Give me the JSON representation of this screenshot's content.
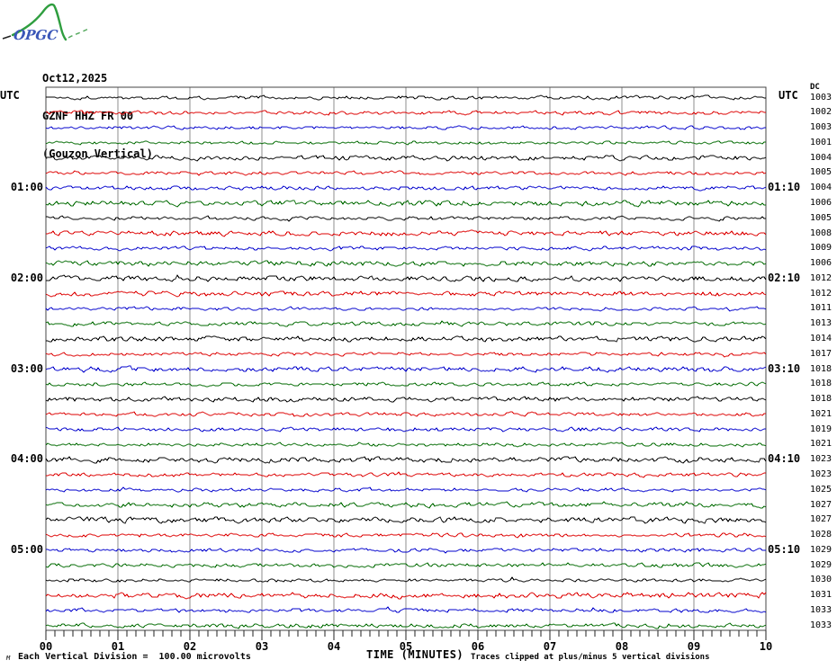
{
  "logo": {
    "text": "OPGC",
    "curve_color": "#2f9e3f",
    "text_color": "#3a56b8"
  },
  "header": {
    "date": "Oct12,2025",
    "station": "GZNF HHZ FR 00",
    "location": "(Gouzon Vertical)"
  },
  "axes": {
    "utc_left": "UTC",
    "utc_right": "UTC",
    "dc_header": "DC",
    "xlabel": "TIME (MINUTES)",
    "x_tick_labels": [
      "00",
      "01",
      "02",
      "03",
      "04",
      "05",
      "06",
      "07",
      "08",
      "09",
      "10"
    ],
    "left_time_labels": [
      {
        "row": 6,
        "text": "01:00"
      },
      {
        "row": 12,
        "text": "02:00"
      },
      {
        "row": 18,
        "text": "03:00"
      },
      {
        "row": 24,
        "text": "04:00"
      },
      {
        "row": 30,
        "text": "05:00"
      }
    ],
    "right_time_labels": [
      {
        "row": 6,
        "text": "01:10"
      },
      {
        "row": 12,
        "text": "02:10"
      },
      {
        "row": 18,
        "text": "03:10"
      },
      {
        "row": 24,
        "text": "04:10"
      },
      {
        "row": 30,
        "text": "05:10"
      }
    ]
  },
  "footer": {
    "scale_note": "Each Vertical Division =  100.00 microvolts",
    "clip_note": "Traces clipped at plus/minus 5 vertical divisions",
    "watermark": "M"
  },
  "colors": {
    "black": "#000000",
    "red": "#dd0000",
    "blue": "#0000cc",
    "green": "#006a00",
    "grid": "#8c8c8c",
    "frame": "#444444"
  },
  "chart_data": {
    "type": "line",
    "kind": "helicorder-seismogram",
    "title": "GZNF HHZ FR 00 (Gouzon Vertical) Oct12,2025",
    "xlabel": "TIME (MINUTES)",
    "x_range_minutes": [
      0,
      10
    ],
    "x_major_ticks": [
      "00",
      "01",
      "02",
      "03",
      "04",
      "05",
      "06",
      "07",
      "08",
      "09",
      "10"
    ],
    "minor_ticks_per_minute": 8,
    "minutes_per_row": 10,
    "start_utc": "00:00",
    "end_utc": "06:00",
    "color_cycle": [
      "black",
      "red",
      "blue",
      "green"
    ],
    "scale_note": "Each Vertical Division = 100.00 microvolts",
    "clip_note": "Traces clipped at plus/minus 5 vertical divisions",
    "amplitude_note": "low-amplitude background noise on all rows, roughly flat traces",
    "rows": [
      {
        "start": "00:00",
        "color": "black",
        "dc": 1003
      },
      {
        "start": "00:10",
        "color": "red",
        "dc": 1002
      },
      {
        "start": "00:20",
        "color": "blue",
        "dc": 1003
      },
      {
        "start": "00:30",
        "color": "green",
        "dc": 1001
      },
      {
        "start": "00:40",
        "color": "black",
        "dc": 1004
      },
      {
        "start": "00:50",
        "color": "red",
        "dc": 1005
      },
      {
        "start": "01:00",
        "color": "blue",
        "dc": 1004
      },
      {
        "start": "01:10",
        "color": "green",
        "dc": 1006
      },
      {
        "start": "01:20",
        "color": "black",
        "dc": 1005
      },
      {
        "start": "01:30",
        "color": "red",
        "dc": 1008
      },
      {
        "start": "01:40",
        "color": "blue",
        "dc": 1009
      },
      {
        "start": "01:50",
        "color": "green",
        "dc": 1006
      },
      {
        "start": "02:00",
        "color": "black",
        "dc": 1012
      },
      {
        "start": "02:10",
        "color": "red",
        "dc": 1012
      },
      {
        "start": "02:20",
        "color": "blue",
        "dc": 1011
      },
      {
        "start": "02:30",
        "color": "green",
        "dc": 1013
      },
      {
        "start": "02:40",
        "color": "black",
        "dc": 1014
      },
      {
        "start": "02:50",
        "color": "red",
        "dc": 1017
      },
      {
        "start": "03:00",
        "color": "blue",
        "dc": 1018
      },
      {
        "start": "03:10",
        "color": "green",
        "dc": 1018
      },
      {
        "start": "03:20",
        "color": "black",
        "dc": 1018
      },
      {
        "start": "03:30",
        "color": "red",
        "dc": 1021
      },
      {
        "start": "03:40",
        "color": "blue",
        "dc": 1019
      },
      {
        "start": "03:50",
        "color": "green",
        "dc": 1021
      },
      {
        "start": "04:00",
        "color": "black",
        "dc": 1023
      },
      {
        "start": "04:10",
        "color": "red",
        "dc": 1023
      },
      {
        "start": "04:20",
        "color": "blue",
        "dc": 1025
      },
      {
        "start": "04:30",
        "color": "green",
        "dc": 1027
      },
      {
        "start": "04:40",
        "color": "black",
        "dc": 1027
      },
      {
        "start": "04:50",
        "color": "red",
        "dc": 1028
      },
      {
        "start": "05:00",
        "color": "blue",
        "dc": 1029
      },
      {
        "start": "05:10",
        "color": "green",
        "dc": 1029
      },
      {
        "start": "05:20",
        "color": "black",
        "dc": 1030
      },
      {
        "start": "05:30",
        "color": "red",
        "dc": 1031
      },
      {
        "start": "05:40",
        "color": "blue",
        "dc": 1033
      },
      {
        "start": "05:50",
        "color": "green",
        "dc": 1033
      }
    ]
  }
}
